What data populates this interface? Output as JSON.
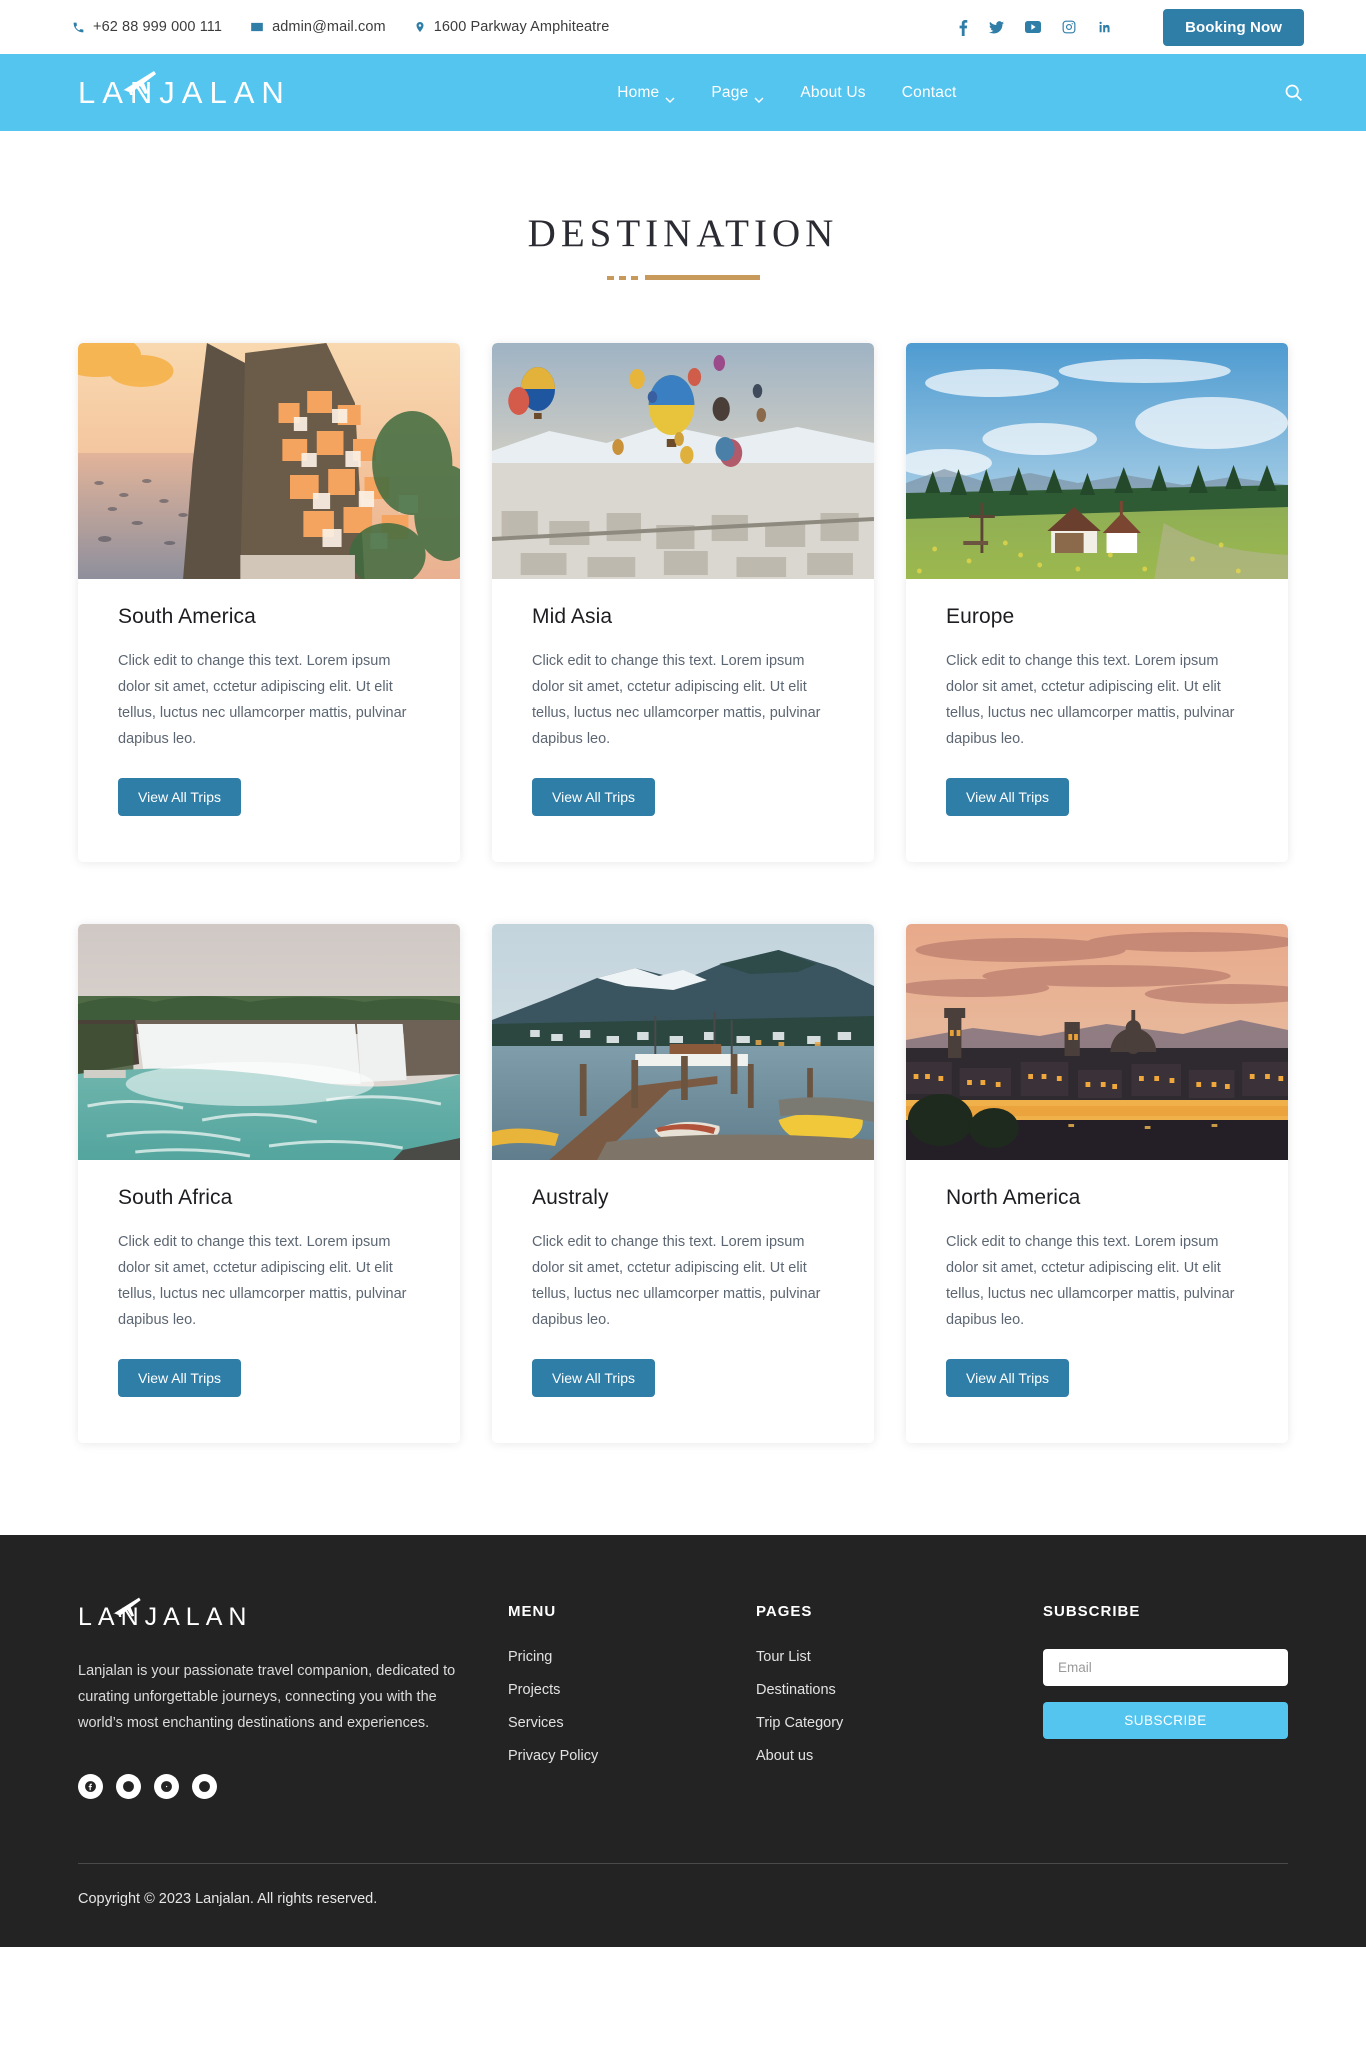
{
  "topbar": {
    "phone": "+62 88 999 000 111",
    "email": "admin@mail.com",
    "address": "1600 Parkway Amphiteatre",
    "phone_icon": "phone-icon",
    "email_icon": "envelope-icon",
    "address_icon": "map-pin-icon",
    "social": [
      {
        "name": "facebook-icon",
        "label": "f"
      },
      {
        "name": "twitter-icon",
        "label": "t"
      },
      {
        "name": "youtube-icon",
        "label": "yt"
      },
      {
        "name": "instagram-icon",
        "label": "ig"
      },
      {
        "name": "linkedin-icon",
        "label": "in"
      }
    ],
    "booking_label": "Booking Now",
    "accent_color": "#2f7ea8"
  },
  "navbar": {
    "brand": "LANJALAN",
    "background_color": "#54c5ef",
    "items": [
      {
        "label": "Home",
        "has_dropdown": true
      },
      {
        "label": "Page",
        "has_dropdown": true
      },
      {
        "label": "About Us",
        "has_dropdown": false
      },
      {
        "label": "Contact",
        "has_dropdown": false
      }
    ],
    "search_icon": "search-icon"
  },
  "section": {
    "title": "DESTINATION",
    "divider_color": "#c79a5b"
  },
  "cards": [
    {
      "title": "South America",
      "text": "Click edit to change this text. Lorem ipsum dolor sit amet, cctetur adipiscing elit. Ut elit tellus, luctus nec ullamcorper mattis, pulvinar dapibus leo.",
      "button": "View All Trips",
      "image_alt": "coastal-cliff-village-sunset"
    },
    {
      "title": "Mid Asia",
      "text": "Click edit to change this text. Lorem ipsum dolor sit amet, cctetur adipiscing elit. Ut elit tellus, luctus nec ullamcorper mattis, pulvinar dapibus leo.",
      "button": "View All Trips",
      "image_alt": "hot-air-balloons-over-snowy-town"
    },
    {
      "title": "Europe",
      "text": "Click edit to change this text. Lorem ipsum dolor sit amet, cctetur adipiscing elit. Ut elit tellus, luctus nec ullamcorper mattis, pulvinar dapibus leo.",
      "button": "View All Trips",
      "image_alt": "alpine-meadow-farmhouse"
    },
    {
      "title": "South Africa",
      "text": "Click edit to change this text. Lorem ipsum dolor sit amet, cctetur adipiscing elit. Ut elit tellus, luctus nec ullamcorper mattis, pulvinar dapibus leo.",
      "button": "View All Trips",
      "image_alt": "wide-waterfall-turquoise-river"
    },
    {
      "title": "Australy",
      "text": "Click edit to change this text. Lorem ipsum dolor sit amet, cctetur adipiscing elit. Ut elit tellus, luctus nec ullamcorper mattis, pulvinar dapibus leo.",
      "button": "View All Trips",
      "image_alt": "lakeside-pier-mountains-dusk"
    },
    {
      "title": "North America",
      "text": "Click edit to change this text. Lorem ipsum dolor sit amet, cctetur adipiscing elit. Ut elit tellus, luctus nec ullamcorper mattis, pulvinar dapibus leo.",
      "button": "View All Trips",
      "image_alt": "historic-city-skyline-sunset"
    }
  ],
  "footer": {
    "logo": "LANJALAN",
    "description": "Lanjalan is your passionate travel companion, dedicated to curating unforgettable journeys, connecting you with the world’s most enchanting destinations and experiences.",
    "social": [
      {
        "name": "facebook-icon"
      },
      {
        "name": "twitter-icon"
      },
      {
        "name": "youtube-icon"
      },
      {
        "name": "pinterest-icon"
      }
    ],
    "menu": {
      "heading": "MENU",
      "links": [
        "Pricing",
        "Projects",
        "Services",
        "Privacy Policy"
      ]
    },
    "pages": {
      "heading": "PAGES",
      "links": [
        "Tour List",
        "Destinations",
        "Trip Category",
        "About us"
      ]
    },
    "subscribe": {
      "heading": "SUBSCRIBE",
      "placeholder": "Email",
      "value": "",
      "button": "SUBSCRIBE",
      "button_color": "#54c5ef"
    },
    "copyright": "Copyright © 2023 Lanjalan. All rights reserved.",
    "background_color": "#232323"
  }
}
